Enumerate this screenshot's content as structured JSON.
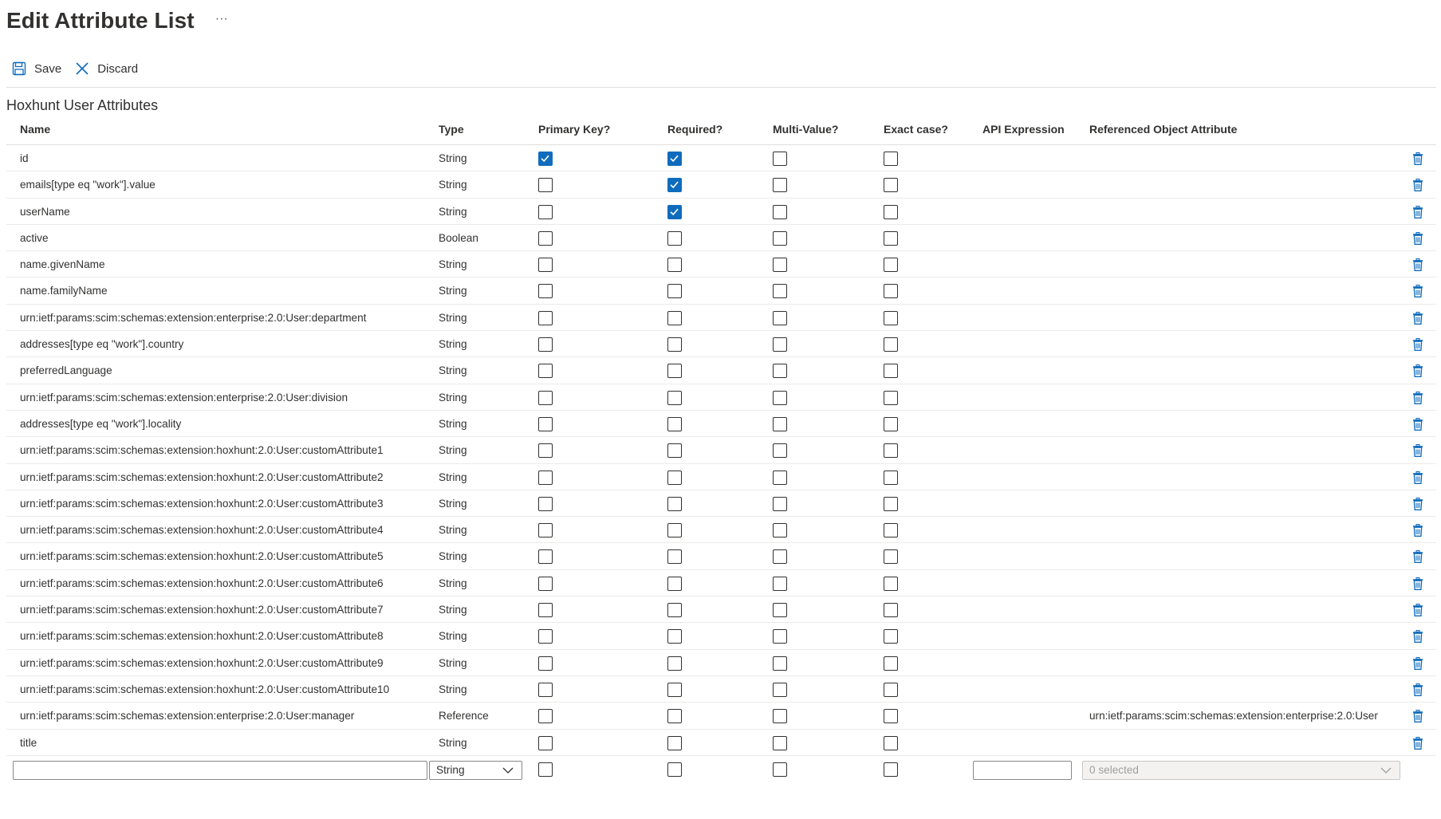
{
  "header": {
    "title": "Edit Attribute List",
    "more_label": "···"
  },
  "toolbar": {
    "save_label": "Save",
    "discard_label": "Discard"
  },
  "section_title": "Hoxhunt User Attributes",
  "columns": {
    "name": "Name",
    "type": "Type",
    "primary_key": "Primary Key?",
    "required": "Required?",
    "multi_value": "Multi-Value?",
    "exact_case": "Exact case?",
    "api_expression": "API Expression",
    "referenced_object_attribute": "Referenced Object Attribute"
  },
  "rows": [
    {
      "name": "id",
      "type": "String",
      "pk": true,
      "req": true,
      "mv": false,
      "ec": false,
      "api": "",
      "ref": ""
    },
    {
      "name": "emails[type eq \"work\"].value",
      "type": "String",
      "pk": false,
      "req": true,
      "mv": false,
      "ec": false,
      "api": "",
      "ref": ""
    },
    {
      "name": "userName",
      "type": "String",
      "pk": false,
      "req": true,
      "mv": false,
      "ec": false,
      "api": "",
      "ref": ""
    },
    {
      "name": "active",
      "type": "Boolean",
      "pk": false,
      "req": false,
      "mv": false,
      "ec": false,
      "api": "",
      "ref": ""
    },
    {
      "name": "name.givenName",
      "type": "String",
      "pk": false,
      "req": false,
      "mv": false,
      "ec": false,
      "api": "",
      "ref": ""
    },
    {
      "name": "name.familyName",
      "type": "String",
      "pk": false,
      "req": false,
      "mv": false,
      "ec": false,
      "api": "",
      "ref": ""
    },
    {
      "name": "urn:ietf:params:scim:schemas:extension:enterprise:2.0:User:department",
      "type": "String",
      "pk": false,
      "req": false,
      "mv": false,
      "ec": false,
      "api": "",
      "ref": ""
    },
    {
      "name": "addresses[type eq \"work\"].country",
      "type": "String",
      "pk": false,
      "req": false,
      "mv": false,
      "ec": false,
      "api": "",
      "ref": ""
    },
    {
      "name": "preferredLanguage",
      "type": "String",
      "pk": false,
      "req": false,
      "mv": false,
      "ec": false,
      "api": "",
      "ref": ""
    },
    {
      "name": "urn:ietf:params:scim:schemas:extension:enterprise:2.0:User:division",
      "type": "String",
      "pk": false,
      "req": false,
      "mv": false,
      "ec": false,
      "api": "",
      "ref": ""
    },
    {
      "name": "addresses[type eq \"work\"].locality",
      "type": "String",
      "pk": false,
      "req": false,
      "mv": false,
      "ec": false,
      "api": "",
      "ref": ""
    },
    {
      "name": "urn:ietf:params:scim:schemas:extension:hoxhunt:2.0:User:customAttribute1",
      "type": "String",
      "pk": false,
      "req": false,
      "mv": false,
      "ec": false,
      "api": "",
      "ref": ""
    },
    {
      "name": "urn:ietf:params:scim:schemas:extension:hoxhunt:2.0:User:customAttribute2",
      "type": "String",
      "pk": false,
      "req": false,
      "mv": false,
      "ec": false,
      "api": "",
      "ref": ""
    },
    {
      "name": "urn:ietf:params:scim:schemas:extension:hoxhunt:2.0:User:customAttribute3",
      "type": "String",
      "pk": false,
      "req": false,
      "mv": false,
      "ec": false,
      "api": "",
      "ref": ""
    },
    {
      "name": "urn:ietf:params:scim:schemas:extension:hoxhunt:2.0:User:customAttribute4",
      "type": "String",
      "pk": false,
      "req": false,
      "mv": false,
      "ec": false,
      "api": "",
      "ref": ""
    },
    {
      "name": "urn:ietf:params:scim:schemas:extension:hoxhunt:2.0:User:customAttribute5",
      "type": "String",
      "pk": false,
      "req": false,
      "mv": false,
      "ec": false,
      "api": "",
      "ref": ""
    },
    {
      "name": "urn:ietf:params:scim:schemas:extension:hoxhunt:2.0:User:customAttribute6",
      "type": "String",
      "pk": false,
      "req": false,
      "mv": false,
      "ec": false,
      "api": "",
      "ref": ""
    },
    {
      "name": "urn:ietf:params:scim:schemas:extension:hoxhunt:2.0:User:customAttribute7",
      "type": "String",
      "pk": false,
      "req": false,
      "mv": false,
      "ec": false,
      "api": "",
      "ref": ""
    },
    {
      "name": "urn:ietf:params:scim:schemas:extension:hoxhunt:2.0:User:customAttribute8",
      "type": "String",
      "pk": false,
      "req": false,
      "mv": false,
      "ec": false,
      "api": "",
      "ref": ""
    },
    {
      "name": "urn:ietf:params:scim:schemas:extension:hoxhunt:2.0:User:customAttribute9",
      "type": "String",
      "pk": false,
      "req": false,
      "mv": false,
      "ec": false,
      "api": "",
      "ref": ""
    },
    {
      "name": "urn:ietf:params:scim:schemas:extension:hoxhunt:2.0:User:customAttribute10",
      "type": "String",
      "pk": false,
      "req": false,
      "mv": false,
      "ec": false,
      "api": "",
      "ref": ""
    },
    {
      "name": "urn:ietf:params:scim:schemas:extension:enterprise:2.0:User:manager",
      "type": "Reference",
      "pk": false,
      "req": false,
      "mv": false,
      "ec": false,
      "api": "",
      "ref": "urn:ietf:params:scim:schemas:extension:enterprise:2.0:User"
    },
    {
      "name": "title",
      "type": "String",
      "pk": false,
      "req": false,
      "mv": false,
      "ec": false,
      "api": "",
      "ref": ""
    }
  ],
  "new_row": {
    "name_value": "",
    "type_selected": "String",
    "pk": false,
    "req": false,
    "mv": false,
    "ec": false,
    "api_value": "",
    "ref_selected": "0 selected"
  },
  "icons": {
    "save": "save-icon",
    "discard": "close-icon",
    "delete": "trash-icon",
    "checkbox_checked": "checkmark-icon",
    "dropdown": "chevron-down-icon",
    "more": "more-icon"
  },
  "colors": {
    "accent": "#0f6cbd",
    "text": "#323130",
    "divider": "#e1dfdd"
  }
}
